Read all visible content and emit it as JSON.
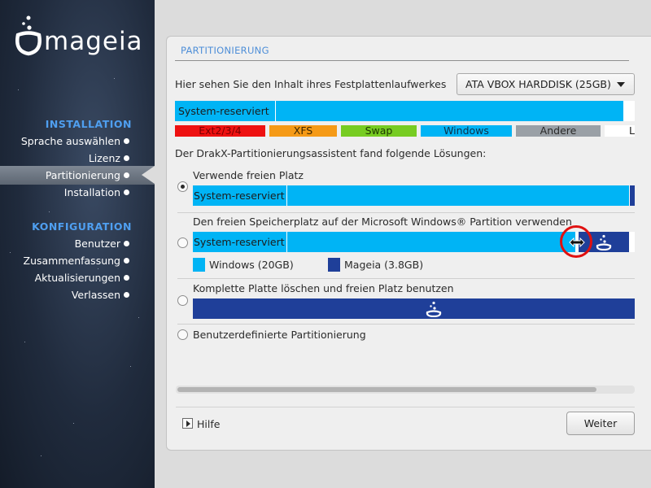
{
  "brand": {
    "name": "mageia"
  },
  "sidebar": {
    "sections": [
      {
        "heading": "INSTALLATION",
        "items": [
          "Sprache auswählen",
          "Lizenz",
          "Partitionierung",
          "Installation"
        ]
      },
      {
        "heading": "KONFIGURATION",
        "items": [
          "Benutzer",
          "Zusammenfassung",
          "Aktualisierungen",
          "Verlassen"
        ]
      }
    ],
    "active_item": "Partitionierung"
  },
  "panel": {
    "title": "PARTITIONIERUNG",
    "disk_prompt": "Hier sehen Sie den Inhalt ihres Festplattenlaufwerkes",
    "disk_select": {
      "value": "ATA VBOX HARDDISK (25GB)"
    },
    "disk_bar": {
      "first_label": "System-reserviert"
    },
    "legend": [
      {
        "label": "Ext2/3/4",
        "color": "#ee1111"
      },
      {
        "label": "XFS",
        "color": "#f59a17"
      },
      {
        "label": "Swap",
        "color": "#77cc22"
      },
      {
        "label": "Windows",
        "color": "#00b4f5"
      },
      {
        "label": "Andere",
        "color": "#9aa0a6"
      },
      {
        "label": "Le",
        "color": "#ffffff"
      }
    ],
    "solutions_prompt": "Der DrakX-Partitionierungsassistent fand folgende Lösungen:",
    "options": [
      {
        "label": "Verwende freien Platz",
        "bar_label": "System-reserviert",
        "selected": true
      },
      {
        "label": "Den freien Speicherplatz auf der Microsoft Windows® Partition verwenden",
        "bar_label": "System-reserviert",
        "selected": false,
        "resize_legend": [
          {
            "label": "Windows (20GB)",
            "color": "#00b4f5"
          },
          {
            "label": "Mageia (3.8GB)",
            "color": "#1f3f99"
          }
        ]
      },
      {
        "label": "Komplette Platte löschen und freien Platz benutzen",
        "selected": false
      },
      {
        "label": "Benutzerdefinierte Partitionierung",
        "selected": false
      }
    ]
  },
  "footer": {
    "help_label": "Hilfe",
    "next_label": "Weiter"
  },
  "colors": {
    "windows": "#00b4f5",
    "mageia": "#1f3f99",
    "accent": "#4f8fd8"
  }
}
